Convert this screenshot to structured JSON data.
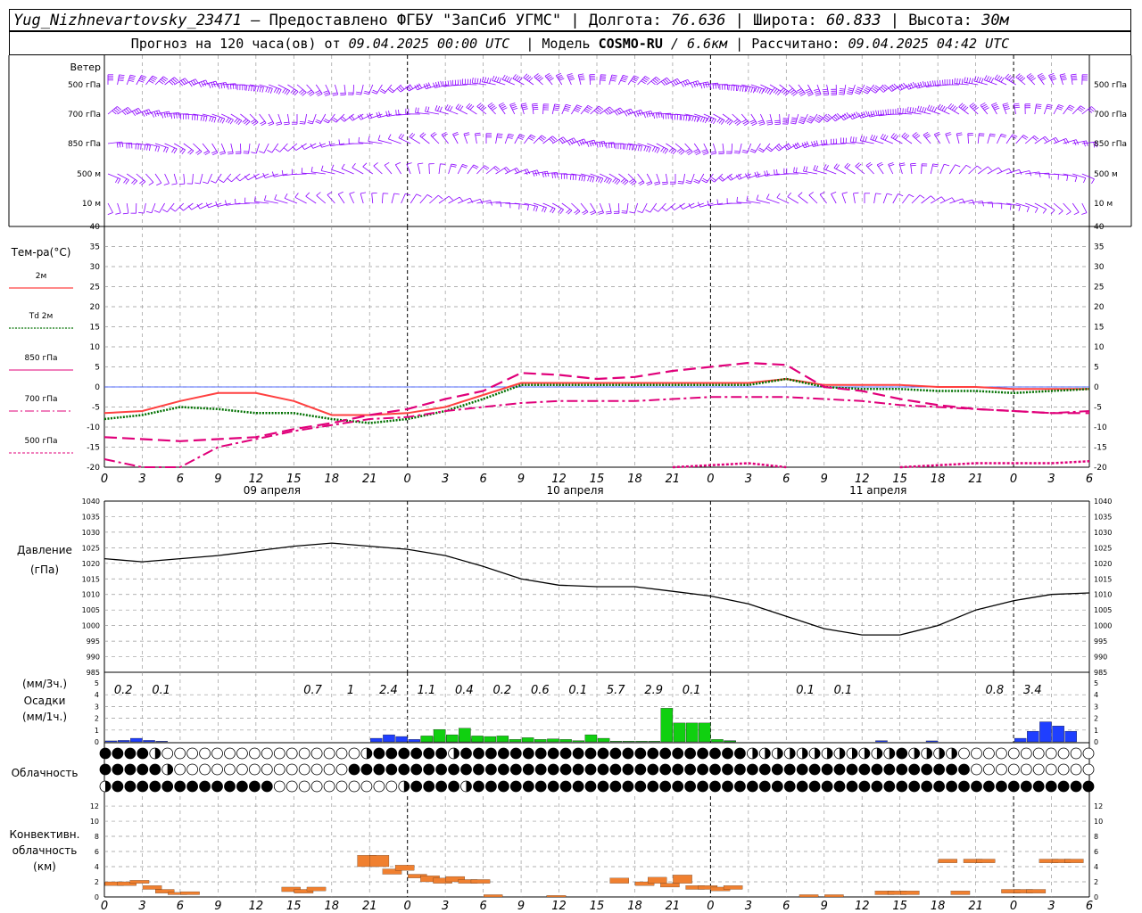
{
  "header": {
    "station": "Yug_Nizhnevartovsky_23471",
    "provider": "– Предоставлено ФГБУ \"ЗапСиб УГМС\"",
    "lon_label": "Долгота:",
    "lon": "76.636",
    "lat_label": "Широта:",
    "lat": "60.833",
    "alt_label": "Высота:",
    "alt": "30м",
    "fc_label": "Прогноз на 120 часа(ов) от",
    "fc_time": "09.04.2025 00:00 UTC",
    "model_label": "Модель",
    "model": "COSMO-RU",
    "resolution": "/ 6.6км",
    "calc_label": "Рассчитано:",
    "calc_time": "09.04.2025 04:42 UTC"
  },
  "x_axis": {
    "hour_ticks": [
      "0",
      "3",
      "6",
      "9",
      "12",
      "15",
      "18",
      "21",
      "0",
      "3",
      "6",
      "9",
      "12",
      "15",
      "18",
      "21",
      "0",
      "3",
      "6",
      "9",
      "12",
      "15",
      "18",
      "21",
      "0",
      "3",
      "6"
    ],
    "dates": [
      "09 апреля",
      "10 апреля",
      "11 апреля"
    ]
  },
  "wind_panel": {
    "title": "Ветер",
    "levels": [
      "500 гПа",
      "700 гПа",
      "850 гПа",
      "500 м",
      "10 м"
    ],
    "colors": {
      "barb": "#8b00ff"
    }
  },
  "temp_panel": {
    "title": "Тем-ра(°С)",
    "y_ticks": [
      "40",
      "35",
      "30",
      "25",
      "20",
      "15",
      "10",
      "5",
      "0",
      "-5",
      "-10",
      "-15",
      "-20"
    ],
    "legend": [
      "2м",
      "Td 2м",
      "850 гПа",
      "700 гПа",
      "500 гПа"
    ]
  },
  "pressure_panel": {
    "title": "Давление",
    "unit": "(гПа)",
    "y_ticks": [
      "1040",
      "1035",
      "1030",
      "1025",
      "1020",
      "1015",
      "1010",
      "1005",
      "1000",
      "995",
      "990",
      "985"
    ]
  },
  "precip_panel": {
    "unit3": "(мм/3ч.)",
    "title": "Осадки",
    "unit1": "(мм/1ч.)",
    "y_ticks": [
      "5",
      "4",
      "3",
      "2",
      "1",
      "0"
    ],
    "labels": [
      {
        "h": 3,
        "t": "0.2"
      },
      {
        "h": 9,
        "t": "0.1"
      },
      {
        "h": 33,
        "t": "0.7"
      },
      {
        "h": 39,
        "t": "1"
      },
      {
        "h": 45,
        "t": "2.4"
      },
      {
        "h": 51,
        "t": "1.1"
      },
      {
        "h": 57,
        "t": "0.4"
      },
      {
        "h": 63,
        "t": "0.2"
      },
      {
        "h": 69,
        "t": "0.6"
      },
      {
        "h": 75,
        "t": "0.1"
      },
      {
        "h": 81,
        "t": "5.7"
      },
      {
        "h": 87,
        "t": "2.9"
      },
      {
        "h": 93,
        "t": "0.1"
      },
      {
        "h": 111,
        "t": "0.1"
      },
      {
        "h": 117,
        "t": "0.1"
      },
      {
        "h": 141,
        "t": "0.8"
      },
      {
        "h": 147,
        "t": "3.4"
      }
    ]
  },
  "cloud_panel": {
    "title": "Облачность"
  },
  "conv_panel": {
    "title_lines": [
      "Конвективн.",
      "облачность",
      "(км)"
    ],
    "y_ticks": [
      "12",
      "10",
      "8",
      "6",
      "4",
      "2",
      "0"
    ]
  },
  "chart_data": [
    {
      "type": "line",
      "title": "Тем-ра(°С)",
      "ylim": [
        -20,
        40
      ],
      "x_hours": [
        0,
        3,
        6,
        9,
        12,
        15,
        18,
        21,
        24,
        27,
        30,
        33,
        36,
        39,
        42,
        45,
        48,
        51,
        54,
        57,
        60,
        63,
        66,
        69,
        72,
        75,
        78
      ],
      "series": [
        {
          "name": "2м",
          "color": "#ff4040",
          "values": [
            -6.5,
            -6,
            -3.5,
            -1.5,
            -1.5,
            -3.5,
            -7,
            -7,
            -6.5,
            -5,
            -2,
            1,
            1,
            1,
            1,
            1,
            1,
            1,
            2,
            0.5,
            0.5,
            0.5,
            0,
            0,
            -0.5,
            -0.5,
            -0.5
          ]
        },
        {
          "name": "Td 2м",
          "color": "#007000",
          "values": [
            -8,
            -7,
            -5,
            -5.5,
            -6.5,
            -6.5,
            -8,
            -9,
            -8,
            -6,
            -3,
            0.5,
            0.5,
            0.5,
            0.5,
            0.5,
            0.5,
            0.5,
            2,
            0,
            -0.5,
            -0.5,
            -1,
            -1,
            -1.5,
            -1,
            -0.5
          ]
        },
        {
          "name": "850 гПа",
          "color": "#e0007a",
          "values": [
            -12.5,
            -13,
            -13.5,
            -13,
            -12.5,
            -10.5,
            -9,
            -7,
            -5.5,
            -3,
            -1,
            3.5,
            3,
            2,
            2.5,
            4,
            5,
            6,
            5.5,
            0,
            -1,
            -3,
            -4.5,
            -5.5,
            -6,
            -6.5,
            -6.5
          ]
        },
        {
          "name": "700 гПа",
          "color": "#e0007a",
          "values": [
            -18,
            -20,
            -20,
            -15,
            -13,
            -11,
            -9.5,
            -8,
            -7.5,
            -6,
            -5,
            -4,
            -3.5,
            -3.5,
            -3.5,
            -3,
            -2.5,
            -2.5,
            -2.5,
            -3,
            -3.5,
            -4.5,
            -5,
            -5.5,
            -6,
            -6.5,
            -6
          ]
        },
        {
          "name": "500 гПа",
          "color": "#e0007a",
          "values": [
            null,
            null,
            null,
            null,
            null,
            null,
            null,
            null,
            null,
            null,
            null,
            null,
            null,
            null,
            null,
            -20,
            -19.5,
            -19,
            -20,
            null,
            null,
            -20,
            -19.5,
            -19,
            -19,
            -19,
            -18.5
          ]
        }
      ]
    },
    {
      "type": "line",
      "title": "Давление",
      "ylim": [
        985,
        1040
      ],
      "x_hours": [
        0,
        3,
        6,
        9,
        12,
        15,
        18,
        21,
        24,
        27,
        30,
        33,
        36,
        39,
        42,
        45,
        48,
        51,
        54,
        57,
        60,
        63,
        66,
        69,
        72,
        75,
        78
      ],
      "series": [
        {
          "name": "Давление",
          "color": "#000000",
          "values": [
            1021.5,
            1020.5,
            1021.5,
            1022.5,
            1024,
            1025.5,
            1026.5,
            1025.5,
            1024.5,
            1022.5,
            1019,
            1015,
            1013,
            1012.5,
            1012.5,
            1011,
            1009.5,
            1007,
            1003,
            999,
            997,
            997,
            1000,
            1005,
            1008,
            1010,
            1010.5
          ]
        }
      ]
    },
    {
      "type": "bar",
      "title": "Осадки",
      "ylim": [
        0,
        5
      ],
      "x_hours": [
        1,
        2,
        3,
        4,
        5,
        6,
        7,
        8,
        9,
        10,
        11,
        12,
        13,
        14,
        15,
        16,
        17,
        18,
        19,
        20,
        21,
        22,
        23,
        24,
        25,
        26,
        27,
        28,
        29,
        30,
        31,
        32,
        33,
        34,
        35,
        36,
        37,
        38,
        39,
        40,
        41,
        42,
        43,
        44,
        45,
        46,
        47,
        48,
        49,
        50,
        51,
        52,
        53,
        54,
        55,
        56,
        57,
        58,
        59,
        60,
        61,
        62,
        63,
        64,
        65,
        66,
        67,
        68,
        69,
        70,
        71,
        72,
        73,
        74,
        75,
        76,
        77,
        78
      ],
      "series": [
        {
          "name": "blue",
          "color": "#1f3fff",
          "values": [
            0.08,
            0.12,
            0.3,
            0.1,
            0.04
          ]
        },
        {
          "name": "green",
          "color": "#10d010",
          "values": []
        }
      ],
      "blue": [
        [
          1,
          0.08
        ],
        [
          2,
          0.12
        ],
        [
          3,
          0.3
        ],
        [
          4,
          0.12
        ],
        [
          5,
          0.05
        ],
        [
          22,
          0.3
        ],
        [
          23,
          0.6
        ],
        [
          24,
          0.45
        ],
        [
          25,
          0.2
        ],
        [
          26,
          0.45
        ],
        [
          27,
          0.45
        ],
        [
          28,
          0.5
        ],
        [
          29,
          0.45
        ],
        [
          30,
          0.25
        ],
        [
          50,
          0.1
        ],
        [
          62,
          0.1
        ],
        [
          66,
          0.08
        ],
        [
          73,
          0.3
        ],
        [
          74,
          0.9
        ],
        [
          75,
          1.7
        ],
        [
          76,
          1.35
        ],
        [
          77,
          0.9
        ]
      ],
      "green": [
        [
          26,
          0.5
        ],
        [
          27,
          1.05
        ],
        [
          28,
          0.6
        ],
        [
          29,
          1.15
        ],
        [
          30,
          0.5
        ],
        [
          31,
          0.45
        ],
        [
          32,
          0.5
        ],
        [
          33,
          0.2
        ],
        [
          34,
          0.35
        ],
        [
          35,
          0.2
        ],
        [
          36,
          0.25
        ],
        [
          37,
          0.2
        ],
        [
          38,
          0.1
        ],
        [
          39,
          0.6
        ],
        [
          40,
          0.3
        ],
        [
          41,
          0.05
        ],
        [
          42,
          0.05
        ],
        [
          43,
          0.05
        ],
        [
          44,
          0.05
        ],
        [
          45,
          2.85
        ],
        [
          46,
          1.6
        ],
        [
          47,
          1.6
        ],
        [
          48,
          1.6
        ],
        [
          49,
          0.2
        ],
        [
          50,
          0.08
        ]
      ]
    },
    {
      "type": "bar",
      "title": "Конвективн. облачность (км)",
      "ylim": [
        0,
        13
      ],
      "color": "#f08030",
      "bars": [
        [
          0,
          1.5,
          2.0
        ],
        [
          1,
          1.5,
          2.0
        ],
        [
          2,
          1.8,
          2.2
        ],
        [
          3,
          1.0,
          1.5
        ],
        [
          4,
          0.5,
          1.0
        ],
        [
          5,
          0.3,
          0.6
        ],
        [
          6,
          0.3,
          0.7
        ],
        [
          14,
          0.7,
          1.3
        ],
        [
          15,
          0.5,
          1.0
        ],
        [
          16,
          0.8,
          1.3
        ],
        [
          20,
          4.0,
          5.5
        ],
        [
          21,
          4.0,
          5.5
        ],
        [
          22,
          3.0,
          3.7
        ],
        [
          23,
          3.5,
          4.2
        ],
        [
          24,
          2.5,
          3.0
        ],
        [
          25,
          2.0,
          2.8
        ],
        [
          26,
          1.8,
          2.5
        ],
        [
          27,
          2.0,
          2.7
        ],
        [
          28,
          1.8,
          2.3
        ],
        [
          29,
          1.8,
          2.3
        ],
        [
          30,
          0.0,
          0.3
        ],
        [
          35,
          0.0,
          0.2
        ],
        [
          40,
          1.8,
          2.5
        ],
        [
          42,
          1.5,
          2.0
        ],
        [
          43,
          1.8,
          2.6
        ],
        [
          44,
          1.3,
          1.8
        ],
        [
          45,
          1.8,
          2.9
        ],
        [
          46,
          1.0,
          1.5
        ],
        [
          47,
          1.0,
          1.5
        ],
        [
          48,
          0.8,
          1.3
        ],
        [
          49,
          1.0,
          1.5
        ],
        [
          55,
          0.0,
          0.3
        ],
        [
          57,
          0.0,
          0.3
        ],
        [
          61,
          0.3,
          0.8
        ],
        [
          62,
          0.3,
          0.8
        ],
        [
          63,
          0.3,
          0.8
        ],
        [
          66,
          4.5,
          5.0
        ],
        [
          67,
          0.3,
          0.8
        ],
        [
          68,
          4.5,
          5.0
        ],
        [
          69,
          4.5,
          5.0
        ],
        [
          71,
          0.5,
          1.0
        ],
        [
          72,
          0.5,
          1.0
        ],
        [
          73,
          0.5,
          1.0
        ],
        [
          74,
          4.5,
          5.0
        ],
        [
          75,
          4.5,
          5.0
        ],
        [
          76,
          4.5,
          5.0
        ]
      ]
    }
  ]
}
